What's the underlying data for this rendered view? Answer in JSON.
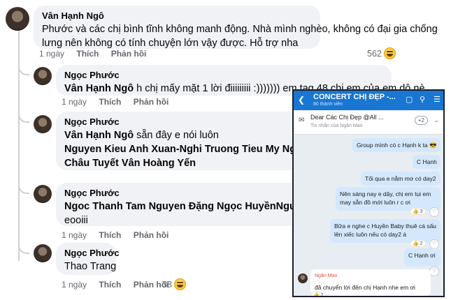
{
  "comments": [
    {
      "author": "Vân Hạnh Ngô",
      "lines": [
        "Phước và các chị bình tĩnh không manh động. Nhà mình nghèo, không có đại gia chống",
        "lưng nên không có tính chuyện lớn vậy được. Hỗ trợ nha"
      ],
      "time": "1 ngày",
      "like": "Thích",
      "reply": "Phản hồi",
      "reactions": "562"
    },
    {
      "author": "Ngọc Phước",
      "mention": "Vân Hạnh Ngô",
      "text": " h chị mấy mặt 1 lời điiiiiiiii :))))))) em tag 48 chị em của em dô nè",
      "time": "1 ngày",
      "like": "Thích",
      "reply": "Phản hồi"
    },
    {
      "author": "Ngọc Phước",
      "mention": "Vân Hạnh Ngô",
      "text": " sẵn đây e nói luôn",
      "tags_line1": "Nguyen Kieu Anh Xuan-Nghi Truong Tieu My Nguyễn Mỹ",
      "tags_line2": "Châu Tuyết Vân Hoàng Yến",
      "time": "1 ngày",
      "like": "Thích",
      "reply": "Phản hồi"
    },
    {
      "author": "Ngọc Phước",
      "tags_line1": "Ngoc Thanh Tam Nguyen Đặng Ngọc HuyềnNguyễn Th",
      "text2": "eooiii",
      "time": "1 ngày",
      "like": "Thích",
      "reply": "Phản hồi"
    },
    {
      "author": "Ngọc Phước",
      "tags_line1": "Thao Trang",
      "time": "1 ngày",
      "like": "Thích",
      "reply": "Phản hồi",
      "reactions": "38"
    }
  ],
  "phone": {
    "title": "CONCERT CHỊ ĐẸP -...",
    "subtitle": "80 thành viên",
    "pinned_title": "Dear Các Chị Đẹp @All ...",
    "pinned_sub": "Tin nhắn của Ngân Mao",
    "pinned_badge": "+2",
    "messages": [
      "Group mình có c Hạnh k ta 😎",
      "C Hạnh",
      "Tối qua e nằm mơ có day2",
      "Nên sáng nay e dậy, chị em tụi em",
      "may sẵn đồ mới luôn r c ơi",
      "Bữa e nghe c Huyền Baby thuê cá sấu",
      "lên xiếc luôn nếu có day2 á",
      "C Hạnh ơi"
    ],
    "reply_author": "Ngân Mao",
    "reply_text": "đã chuyển lời đến chị Hạnh nhe em ơi",
    "reaction_3": "3",
    "reaction_2a": "2",
    "reaction_2b": "2"
  },
  "colors": {
    "bubble": "#f0f2f5",
    "meta": "#65676b",
    "phone_header": "#1976d2",
    "phone_msg": "#d4e8fd"
  }
}
